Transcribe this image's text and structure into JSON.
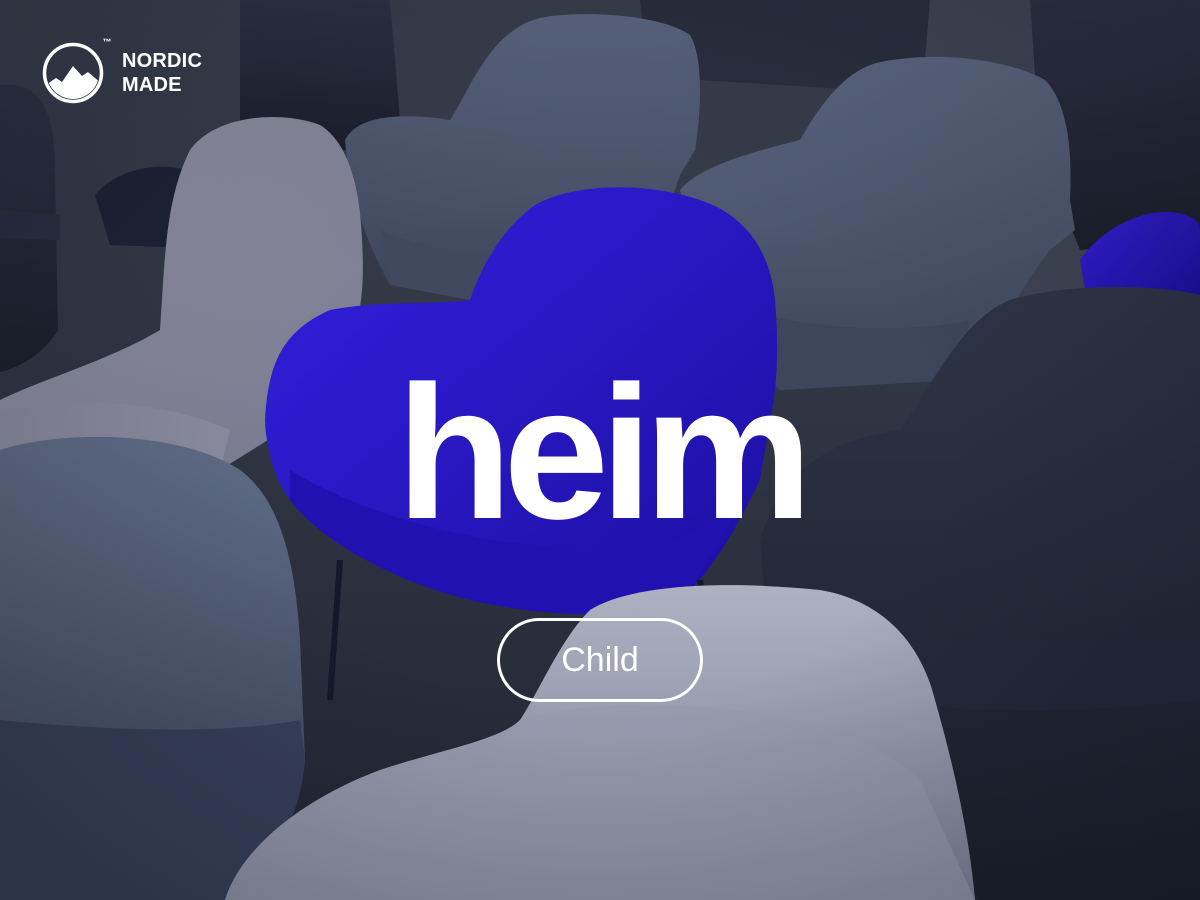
{
  "brand": {
    "line1": "NORDIC",
    "line2": "MADE",
    "trademark": "™",
    "icon": "mountain-circle-icon"
  },
  "hero": {
    "title": "heim",
    "button_label": "Child"
  },
  "background": {
    "subject": "chairs",
    "colors": {
      "slate": "#4d5a72",
      "dark_navy": "#262b3b",
      "grey_fabric": "#8e8fa3",
      "cobalt": "#2414c4",
      "light_grey": "#9ea2b3"
    }
  }
}
